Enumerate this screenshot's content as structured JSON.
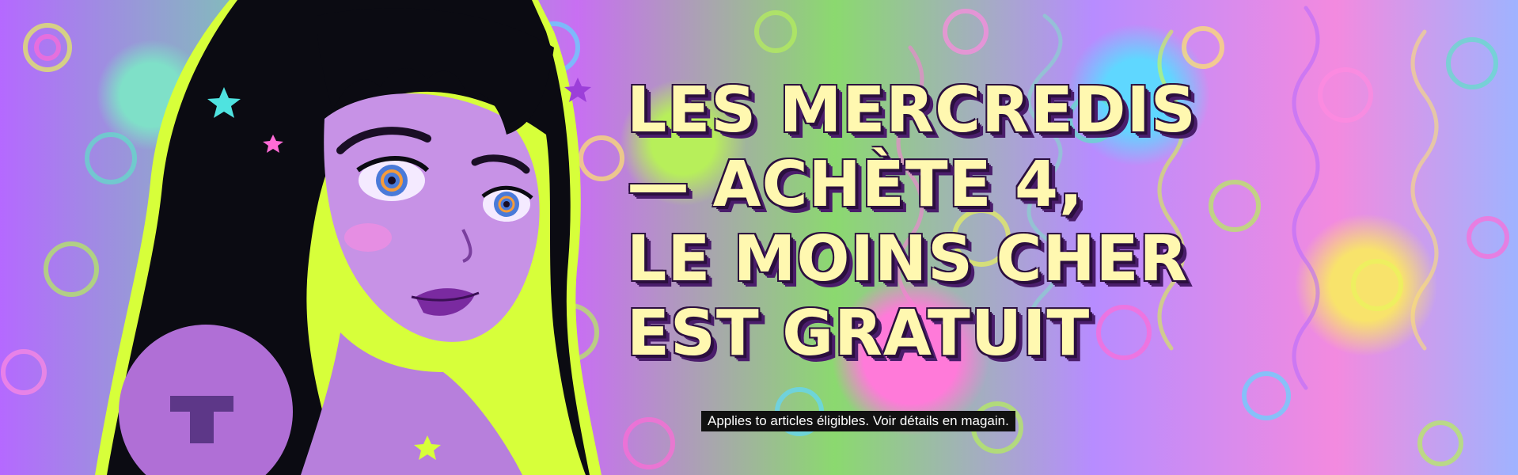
{
  "banner": {
    "headline": {
      "line1": "LES MERCREDIS",
      "line2": "— ACHÈTE 4,",
      "line3": "LE MOINS CHER",
      "line4": "EST GRATUIT"
    },
    "disclaimer": "Applies to articles éligibles. Voir détails en magain.",
    "colors": {
      "headline_fill": "#fff8b0",
      "headline_shadow": "#2b0f3e",
      "disclaimer_bg": "#111111",
      "disclaimer_text": "#ffffff",
      "hair": "#0b0b12",
      "skin": "#c792e6",
      "outline": "#d7ff3a"
    },
    "illustration": "comic-woman-illustration",
    "background": "psychedelic-swirl-pattern"
  }
}
